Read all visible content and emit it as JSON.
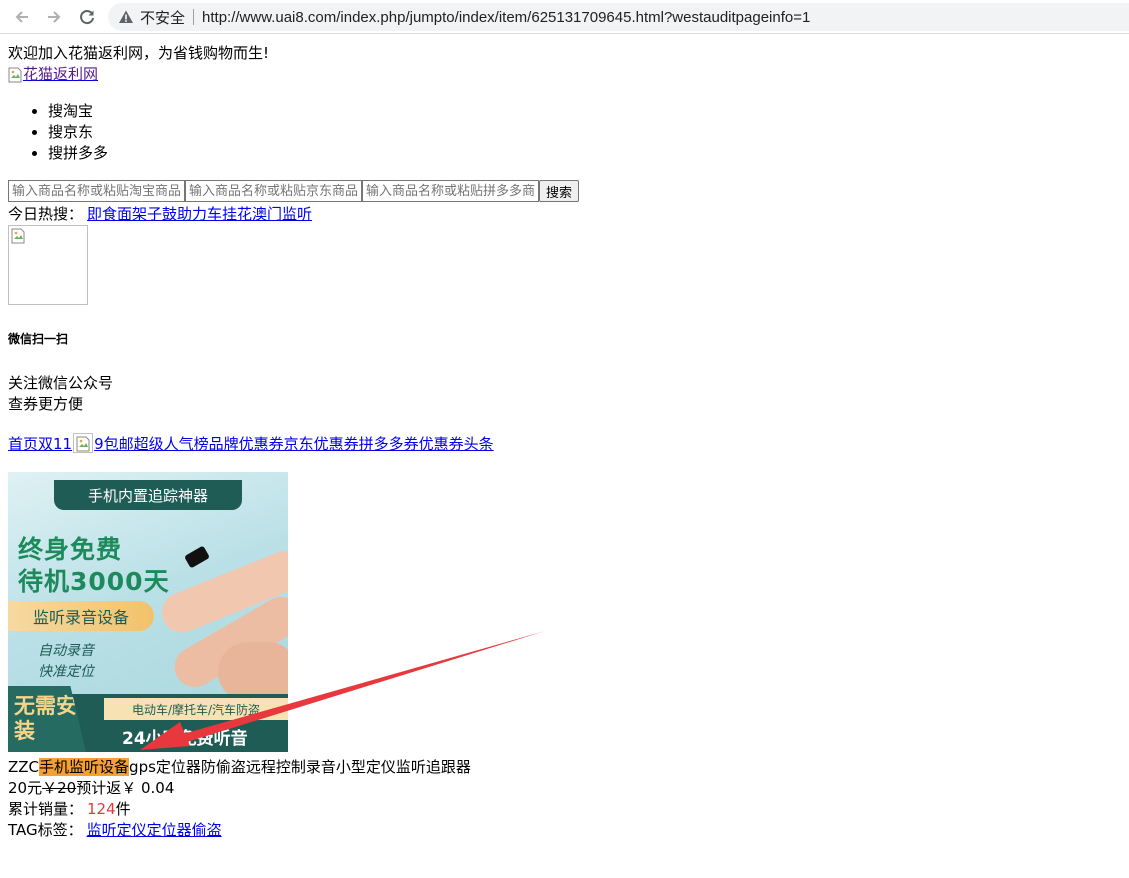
{
  "browser": {
    "insecure_label": "不安全",
    "url": "http://www.uai8.com/index.php/jumpto/index/item/625131709645.html?westauditpageinfo=1"
  },
  "header": {
    "welcome": "欢迎加入花猫返利网，为省钱购物而生!",
    "logo_alt": "花猫返利网"
  },
  "search": {
    "tabs": [
      "搜淘宝",
      "搜京东",
      "搜拼多多"
    ],
    "placeholders": [
      "输入商品名称或粘贴淘宝商品",
      "输入商品名称或粘贴京东商品",
      "输入商品名称或粘贴拼多多商品"
    ],
    "button": "搜索"
  },
  "hot": {
    "label": "今日热搜：",
    "link": "即食面架子鼓助力车挂花澳门监听"
  },
  "wechat": {
    "heading": "微信扫一扫",
    "line1": "关注微信公众号",
    "line2": "查券更方便"
  },
  "nav": {
    "before_img": "首页双11",
    "after_img": "9包邮超级人气榜品牌优惠券京东优惠券拼多多券优惠券头条"
  },
  "product_image": {
    "banner": "手机内置追踪神器",
    "big1": "终身免费",
    "big2": "待机3000天",
    "pill": "监听录音设备",
    "italic1": "自动录音",
    "italic2": "快准定位",
    "bottom_left": "无需安装",
    "bottom_strip": "电动车/摩托车/汽车防盗",
    "bottom_text": "24小时免费听音"
  },
  "product": {
    "title_prefix": "ZZC",
    "title_highlight": "手机监听设备",
    "title_suffix": "gps定位器防偷盗远程控制录音小型定仪监听追跟器",
    "price": "20元",
    "orig_price": "￥20",
    "rebate_label": "预计返￥",
    "rebate": " 0.04",
    "sales_label": "累计销量：",
    "sales_value": "124",
    "sales_unit": "件",
    "tag_label": "TAG标签：",
    "tag_link": "监听定仪定位器偷盗"
  },
  "colors": {
    "highlight": "#f5a032",
    "arrow": "#e8383d",
    "link": "#0000ee",
    "sales": "#e4393c"
  },
  "icons": [
    "back-arrow-icon",
    "forward-arrow-icon",
    "reload-icon",
    "warning-icon",
    "broken-image-icon"
  ]
}
